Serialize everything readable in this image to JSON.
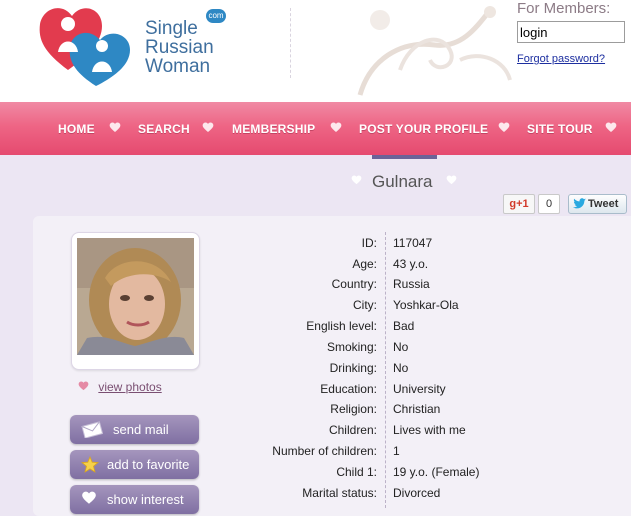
{
  "brand": {
    "line1": "Single",
    "line2": "Russian",
    "line3": "Woman",
    "badge": "com"
  },
  "members": {
    "title": "For Members:",
    "login_value": "login",
    "forgot_label": "Forgot password?"
  },
  "nav": [
    "HOME",
    "SEARCH",
    "MEMBERSHIP",
    "POST YOUR PROFILE",
    "SITE TOUR"
  ],
  "profile": {
    "name": "Gulnara"
  },
  "social": {
    "gplus_label": "g+1",
    "gplus_count": "0",
    "tweet_label": "Tweet"
  },
  "actions": {
    "view_photos": "view photos",
    "send_mail": "send mail",
    "add_favorite": "add to favorite",
    "show_interest": "show interest"
  },
  "details": [
    {
      "label": "ID:",
      "value": "117047"
    },
    {
      "label": "Age:",
      "value": "43 y.o."
    },
    {
      "label": "Country:",
      "value": "Russia"
    },
    {
      "label": "City:",
      "value": "Yoshkar-Ola"
    },
    {
      "label": "English level:",
      "value": "Bad"
    },
    {
      "label": "Smoking:",
      "value": "No"
    },
    {
      "label": "Drinking:",
      "value": "No"
    },
    {
      "label": "Education:",
      "value": "University"
    },
    {
      "label": "Religion:",
      "value": "Christian"
    },
    {
      "label": "Children:",
      "value": "Lives with me"
    },
    {
      "label": "Number of children:",
      "value": "1"
    },
    {
      "label": "Child 1:",
      "value": "19 y.o. (Female)"
    },
    {
      "label": "Marital status:",
      "value": "Divorced"
    }
  ],
  "colors": {
    "nav": "#ee6585",
    "button": "#8f80b0",
    "link": "#1d2fa0",
    "accent": "#e23b4e"
  }
}
